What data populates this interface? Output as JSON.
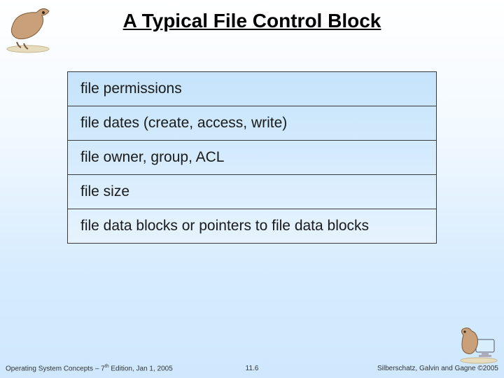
{
  "title": "A Typical File Control Block",
  "fcb": {
    "rows": [
      "file permissions",
      "file dates (create, access, write)",
      "file owner, group, ACL",
      "file size",
      "file data blocks or pointers to file data blocks"
    ]
  },
  "footer": {
    "left_prefix": "Operating System Concepts – 7",
    "left_sup": "th",
    "left_suffix": " Edition, Jan 1, 2005",
    "center": "11.6",
    "right": "Silberschatz, Galvin and Gagne ©2005"
  },
  "icons": {
    "topleft": "dinosaur-icon",
    "bottomright": "dinosaur-monitor-icon"
  }
}
